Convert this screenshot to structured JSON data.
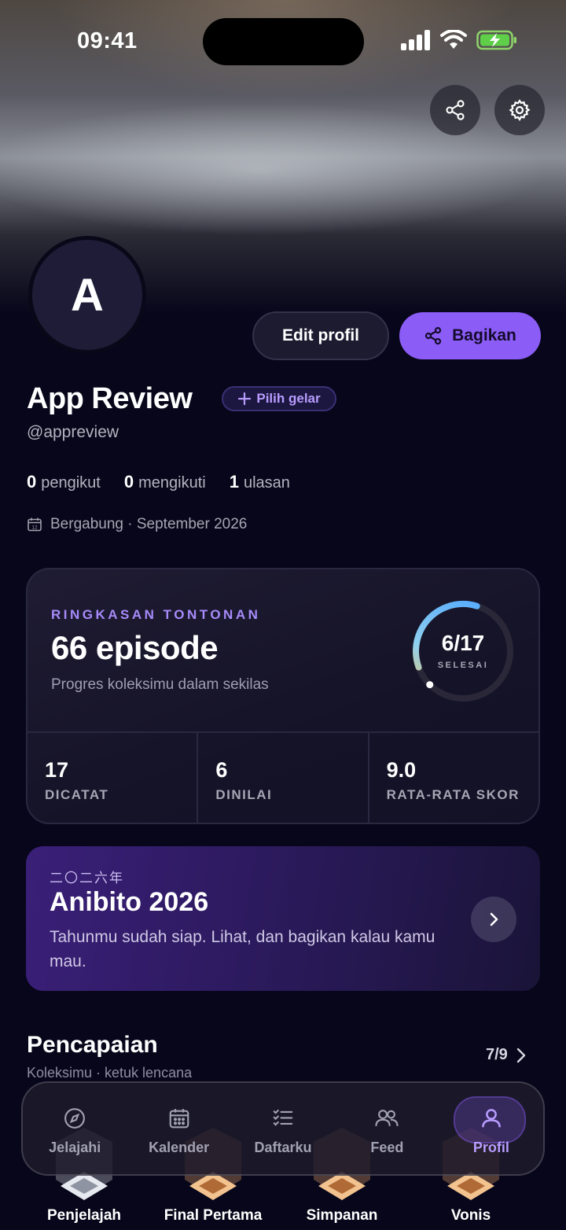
{
  "status_bar": {
    "time": "09:41"
  },
  "profile": {
    "avatar_letter": "A",
    "name": "App Review",
    "handle": "@appreview",
    "title_chip": "Pilih gelar",
    "edit_label": "Edit profil",
    "share_label": "Bagikan",
    "followers_count": "0",
    "followers_label": "pengikut",
    "following_count": "0",
    "following_label": "mengikuti",
    "reviews_count": "1",
    "reviews_label": "ulasan",
    "joined": "Bergabung · September 2026"
  },
  "summary": {
    "kicker": "RINGKASAN TONTONAN",
    "episodes": "66 episode",
    "subtitle": "Progres koleksimu dalam sekilas",
    "ring_value": "6/17",
    "ring_label": "SELESAI",
    "ring_progress": 0.353,
    "metrics": [
      {
        "value": "17",
        "label": "DICATAT"
      },
      {
        "value": "6",
        "label": "DINILAI"
      },
      {
        "value": "9.0",
        "label": "RATA-RATA SKOR"
      }
    ]
  },
  "wrapped": {
    "kicker": "二〇二六年",
    "title": "Anibito 2026",
    "description": "Tahunmu sudah siap. Lihat, dan bagikan kalau kamu mau."
  },
  "achievements": {
    "title": "Pencapaian",
    "subtitle": "Koleksimu · ketuk lencana",
    "count": "7/9",
    "badges": [
      {
        "label": "Penjelajah",
        "color": "#c9cdd6"
      },
      {
        "label": "Final Pertama",
        "color": "#e0a06a"
      },
      {
        "label": "Simpanan",
        "color": "#e0a06a"
      },
      {
        "label": "Vonis",
        "color": "#e0a06a"
      }
    ]
  },
  "tabbar": {
    "tabs": [
      {
        "label": "Jelajahi",
        "icon": "compass-icon"
      },
      {
        "label": "Kalender",
        "icon": "calendar-icon"
      },
      {
        "label": "Daftarku",
        "icon": "checklist-icon"
      },
      {
        "label": "Feed",
        "icon": "people-icon"
      },
      {
        "label": "Profil",
        "icon": "user-icon"
      }
    ],
    "active": "Profil"
  },
  "colors": {
    "accent": "#8b5cf6",
    "background": "#07061a"
  }
}
